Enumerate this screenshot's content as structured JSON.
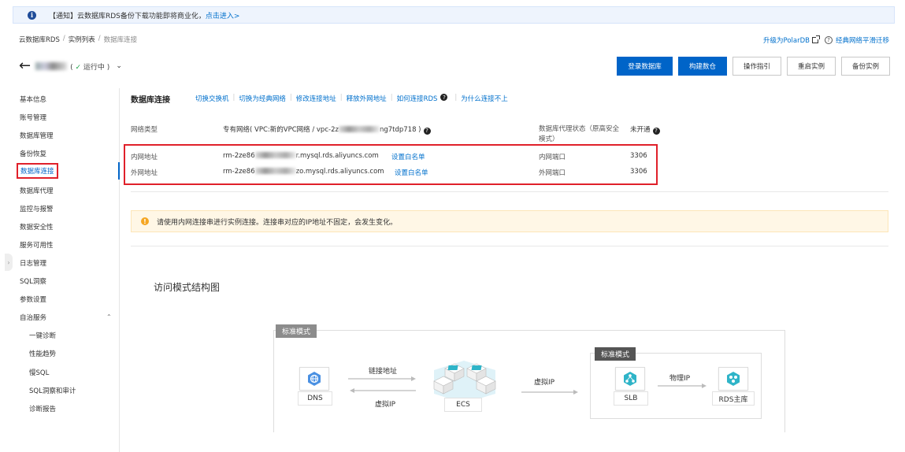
{
  "notice": {
    "text": "【通知】云数据库RDS备份下载功能即将商业化，",
    "link": "点击进入>"
  },
  "breadcrumb": {
    "items": [
      "云数据库RDS",
      "实例列表",
      "数据库连接"
    ],
    "sep": "/"
  },
  "top_right": {
    "polardb": "升级为PolarDB",
    "classic": "经典网络平滑迁移"
  },
  "instance": {
    "status": "运行中",
    "status_prefix": "(",
    "status_suffix": ")"
  },
  "toolbar": {
    "buttons": [
      "登录数据库",
      "构建数仓",
      "操作指引",
      "重启实例",
      "备份实例"
    ]
  },
  "sidebar": {
    "items": [
      "基本信息",
      "账号管理",
      "数据库管理",
      "备份恢复",
      "数据库连接",
      "数据库代理",
      "监控与报警",
      "数据安全性",
      "服务可用性",
      "日志管理",
      "SQL洞察",
      "参数设置",
      "自治服务"
    ],
    "sub_items": [
      "一键诊断",
      "性能趋势",
      "慢SQL",
      "SQL洞察和审计",
      "诊断报告"
    ]
  },
  "connection": {
    "title": "数据库连接",
    "links": [
      "切换交换机",
      "切换为经典网络",
      "修改连接地址",
      "释放外网地址",
      "如何连接RDS",
      "为什么连接不上"
    ],
    "network_label": "网络类型",
    "network_value": "专有网络( VPC:新的VPC网络 / vpc-2z",
    "network_value_tail": "ng7tdp718 )",
    "proxy_label": "数据库代理状态（原高安全模式）",
    "proxy_value": "未开通",
    "internal_label": "内网地址",
    "internal_addr_head": "rm-2ze86",
    "internal_addr_tail": "r.mysql.rds.aliyuncs.com",
    "internal_whitelist": "设置白名单",
    "internal_port_label": "内网端口",
    "internal_port": "3306",
    "external_label": "外网地址",
    "external_addr_head": "rm-2ze86",
    "external_addr_tail": "zo.mysql.rds.aliyuncs.com",
    "external_whitelist": "设置白名单",
    "external_port_label": "外网端口",
    "external_port": "3306"
  },
  "warning": {
    "text": "请使用内网连接串进行实例连接。连接串对应的IP地址不固定，会发生变化。"
  },
  "diagram": {
    "title": "访问模式结构图",
    "outer_tag": "标准模式",
    "inner_tag": "标准模式",
    "dns": "DNS",
    "ecs": "ECS",
    "slb": "SLB",
    "rds": "RDS主库",
    "link_addr": "链接地址",
    "vip1": "虚拟IP",
    "vip2": "虚拟IP",
    "phys_ip": "物理IP"
  },
  "colors": {
    "primary": "#0064c8",
    "link": "#0070cc",
    "highlight": "#e0202a",
    "warning_bg": "#fff7e6",
    "icon_blue": "#4a90e2",
    "icon_teal": "#2fb4c8"
  }
}
